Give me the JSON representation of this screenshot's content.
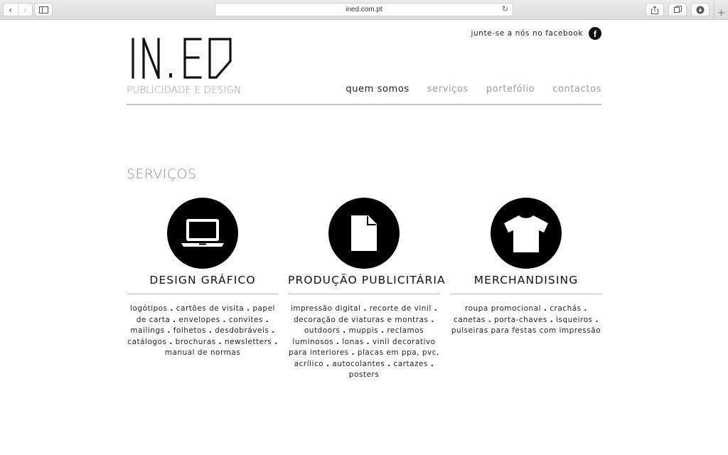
{
  "browser": {
    "url": "ined.com.pt",
    "back_icon": "chevron-left-icon",
    "forward_icon": "chevron-right-icon"
  },
  "header": {
    "logo_text": "IN.ED",
    "tagline": "PUBLICIDADE E DESIGN",
    "facebook_text": "junte-se a nós no facebook",
    "facebook_icon": "f",
    "menu": [
      {
        "label": "quem somos",
        "active": true
      },
      {
        "label": "serviços",
        "active": false
      },
      {
        "label": "portefólio",
        "active": false
      },
      {
        "label": "contactos",
        "active": false
      }
    ]
  },
  "services": {
    "title": "SERVIÇOS",
    "items": [
      {
        "icon": "laptop-icon",
        "title": "DESIGN GRÁFICO",
        "items": [
          "logótipos",
          "cartões de visita",
          "papel de carta",
          "envelopes",
          "convites",
          "mailings",
          "folhetos",
          "desdobráveis",
          "catálogos",
          "brochuras",
          "newsletters",
          "manual de normas"
        ]
      },
      {
        "icon": "document-icon",
        "title": "PRODUÇÃO PUBLICITÁRIA",
        "items": [
          "impressão digital",
          "recorte de vinil",
          "decoração de viaturas e montras",
          "outdoors",
          "muppis",
          "reclamos luminosos",
          "lonas",
          "vinil decorativo para interiores",
          "placas em ppa, pvc, acrílico",
          "autocolantes",
          "cartazes",
          "posters"
        ]
      },
      {
        "icon": "tshirt-icon",
        "title": "MERCHANDISING",
        "items": [
          "roupa promocional",
          "crachás",
          "canetas",
          "porta-chaves",
          "isqueiros",
          "pulseiras para festas com impressão"
        ]
      }
    ]
  }
}
